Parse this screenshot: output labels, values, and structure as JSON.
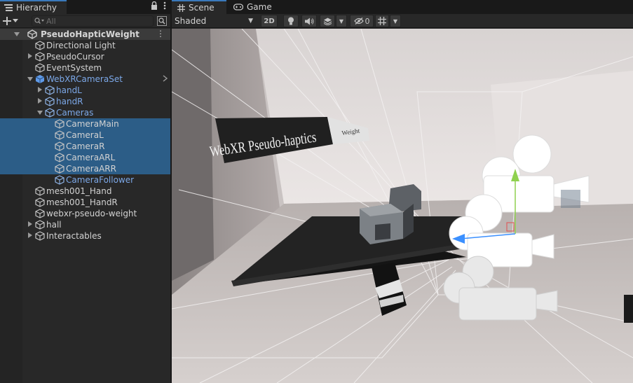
{
  "hierarchy": {
    "tab_label": "Hierarchy",
    "search_placeholder": "All",
    "scene_name": "PseudoHapticWeight",
    "items": [
      {
        "label": "Directional Light",
        "depth": 0,
        "expand": "none",
        "selected": false,
        "prefab": false
      },
      {
        "label": "PseudoCursor",
        "depth": 0,
        "expand": "collapsed",
        "selected": false,
        "prefab": false
      },
      {
        "label": "EventSystem",
        "depth": 0,
        "expand": "none",
        "selected": false,
        "prefab": false
      },
      {
        "label": "WebXRCameraSet",
        "depth": 0,
        "expand": "expanded",
        "selected": false,
        "prefab": true
      },
      {
        "label": "handL",
        "depth": 1,
        "expand": "collapsed",
        "selected": false,
        "prefab": true
      },
      {
        "label": "handR",
        "depth": 1,
        "expand": "collapsed",
        "selected": false,
        "prefab": true
      },
      {
        "label": "Cameras",
        "depth": 1,
        "expand": "expanded",
        "selected": false,
        "prefab": true
      },
      {
        "label": "CameraMain",
        "depth": 2,
        "expand": "none",
        "selected": true,
        "prefab": false
      },
      {
        "label": "CameraL",
        "depth": 2,
        "expand": "none",
        "selected": true,
        "prefab": false
      },
      {
        "label": "CameraR",
        "depth": 2,
        "expand": "none",
        "selected": true,
        "prefab": false
      },
      {
        "label": "CameraARL",
        "depth": 2,
        "expand": "none",
        "selected": true,
        "prefab": false
      },
      {
        "label": "CameraARR",
        "depth": 2,
        "expand": "none",
        "selected": true,
        "prefab": false
      },
      {
        "label": "CameraFollower",
        "depth": 2,
        "expand": "none",
        "selected": false,
        "prefab": true
      },
      {
        "label": "mesh001_Hand",
        "depth": 0,
        "expand": "none",
        "selected": false,
        "prefab": false
      },
      {
        "label": "mesh001_HandR",
        "depth": 0,
        "expand": "none",
        "selected": false,
        "prefab": false
      },
      {
        "label": "webxr-pseudo-weight",
        "depth": 0,
        "expand": "none",
        "selected": false,
        "prefab": false
      },
      {
        "label": "hall",
        "depth": 0,
        "expand": "collapsed",
        "selected": false,
        "prefab": false
      },
      {
        "label": "Interactables",
        "depth": 0,
        "expand": "collapsed",
        "selected": false,
        "prefab": false
      }
    ]
  },
  "scene": {
    "tabs": [
      {
        "label": "Scene"
      },
      {
        "label": "Game"
      }
    ],
    "shading_mode": "Shaded",
    "mode_2d_label": "2D",
    "hidden_count": "0",
    "sign_title": "WebXR Pseudo-haptics",
    "sign_tag": "Weight"
  },
  "colors": {
    "selection": "#2c5d87",
    "prefab_text": "#7ca8e8",
    "tab_accent": "#3a79bb"
  }
}
